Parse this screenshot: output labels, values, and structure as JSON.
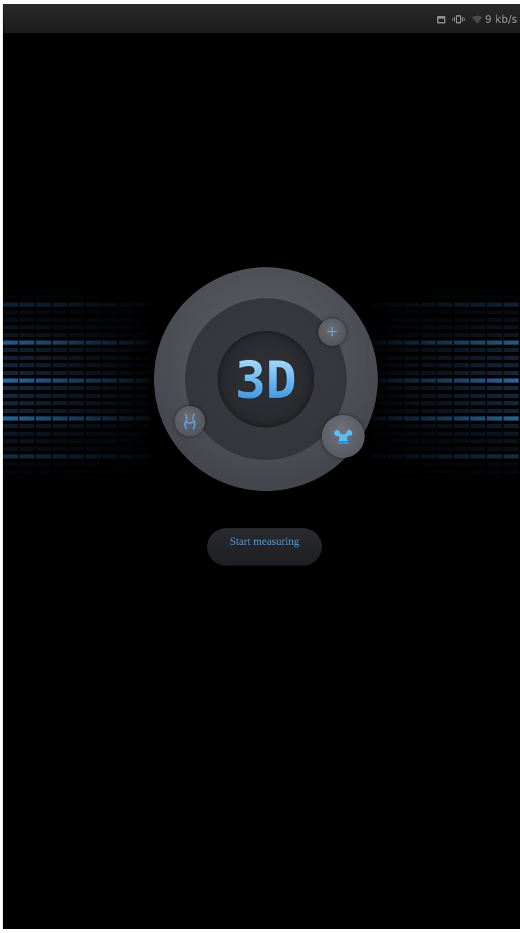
{
  "status_bar": {
    "icons": [
      "calendar-icon",
      "vibrate-icon",
      "wifi-icon"
    ],
    "network_speed": "9 kb/s"
  },
  "dial": {
    "logo_text": "3D",
    "satellites": [
      "add-icon",
      "body-shape-icon",
      "muscle-icon"
    ]
  },
  "actions": {
    "start_label": "Start measuring"
  },
  "colors": {
    "accent": "#4f98d8",
    "logo_light": "#9fd4ff",
    "logo_dark": "#2f82d6",
    "background": "#000000",
    "dial": "#4c4e55"
  }
}
